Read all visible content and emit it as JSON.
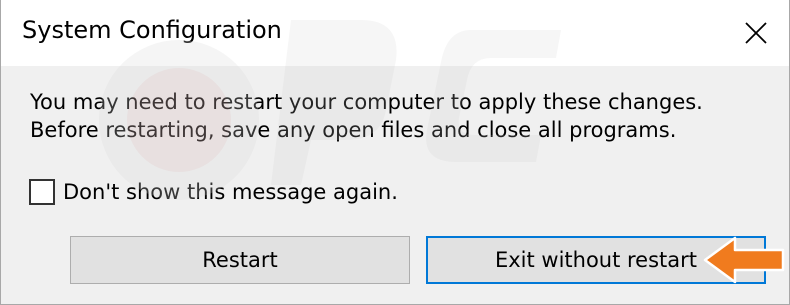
{
  "window": {
    "title": "System Configuration"
  },
  "message": {
    "line1": "You may need to restart your computer to apply these changes.",
    "line2": "Before restarting, save any open files and close all programs."
  },
  "checkbox": {
    "label": "Don't show this message again.",
    "checked": false
  },
  "buttons": {
    "restart_label": "Restart",
    "exit_label": "Exit without restart"
  },
  "colors": {
    "focus_border": "#0078d7",
    "arrow": "#f07b1e"
  },
  "icons": {
    "close": "close-icon",
    "arrow": "orange-arrow-icon"
  }
}
